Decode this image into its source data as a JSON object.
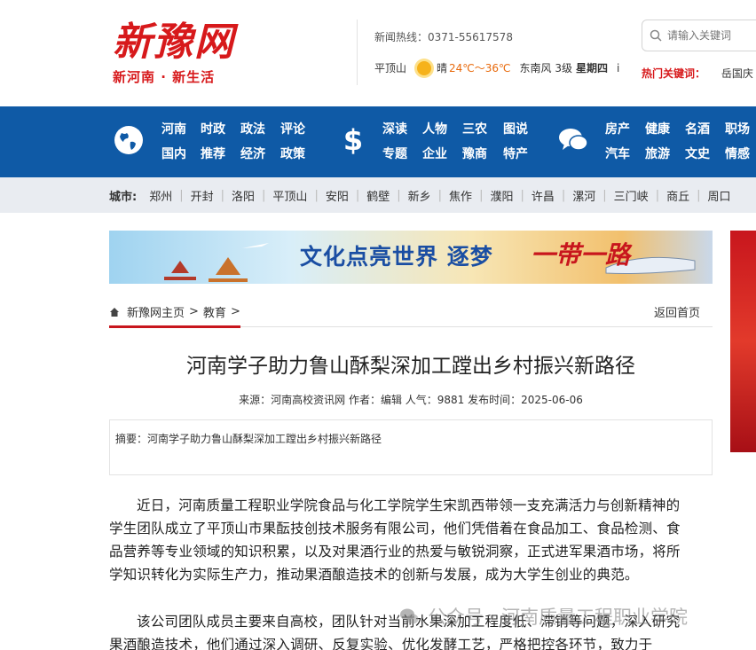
{
  "header": {
    "logo_main": "新豫网",
    "logo_sub": "新河南 · 新生活",
    "hotline": "新闻热线：0371-55617578",
    "weather": {
      "city": "平顶山",
      "condition": "晴",
      "temp": "24℃～36℃",
      "wind": "东南风 3级",
      "weekday": "星期四",
      "extra": "i"
    },
    "search_placeholder": "请输入关键词",
    "hot_label": "热门关键词：",
    "hot_items": [
      "岳国庆"
    ]
  },
  "nav": {
    "group1": [
      [
        "河南",
        "国内"
      ],
      [
        "时政",
        "推荐"
      ],
      [
        "政法",
        "经济"
      ],
      [
        "评论",
        "政策"
      ]
    ],
    "group2": [
      [
        "深读",
        "专题"
      ],
      [
        "人物",
        "企业"
      ],
      [
        "三农",
        "豫商"
      ],
      [
        "图说",
        "特产"
      ]
    ],
    "group3": [
      [
        "房产",
        "汽车"
      ],
      [
        "健康",
        "旅游"
      ],
      [
        "名酒",
        "文史"
      ],
      [
        "职场",
        "情感"
      ]
    ],
    "icons": [
      "globe-icon",
      "dollar-icon",
      "chat-icon"
    ]
  },
  "city": {
    "label": "城市:",
    "items": [
      "郑州",
      "开封",
      "洛阳",
      "平顶山",
      "安阳",
      "鹤壁",
      "新乡",
      "焦作",
      "濮阳",
      "许昌",
      "漯河",
      "三门峡",
      "商丘",
      "周口"
    ]
  },
  "banner": {
    "title": "文化点亮世界  逐梦",
    "red": "一带一路"
  },
  "breadcrumb": {
    "home": "新豫网主页",
    "sep": ">",
    "section": "教育",
    "back": "返回首页"
  },
  "article": {
    "title": "河南学子助力鲁山酥梨深加工蹚出乡村振兴新路径",
    "meta": "来源：河南高校资讯网 作者：编辑 人气：9881 发布时间：2025-06-06",
    "summary": "摘要：河南学子助力鲁山酥梨深加工蹚出乡村振兴新路径",
    "p1": "近日，河南质量工程职业学院食品与化工学院学生宋凯西带领一支充满活力与创新精神的学生团队成立了平顶山市果酝技创技术服务有限公司，他们凭借着在食品加工、食品检测、食品营养等专业领域的知识积累，以及对果酒行业的热爱与敏锐洞察，正式进军果酒市场，将所学知识转化为实际生产力，推动果酒酿造技术的创新与发展，成为大学生创业的典范。",
    "p2": "该公司团队成员主要来自高校，团队针对当前水果深加工程度低、滞销等问题，深入研究果酒酿造技术，他们通过深入调研、反复实验、优化发酵工艺，严格把控各环节，致力于"
  },
  "watermark": "公众号 · 河南质量工程职业学院",
  "colors": {
    "brand_red": "#d7191b",
    "nav_blue": "#0f5aa6",
    "city_bg": "#e9ecf1"
  }
}
